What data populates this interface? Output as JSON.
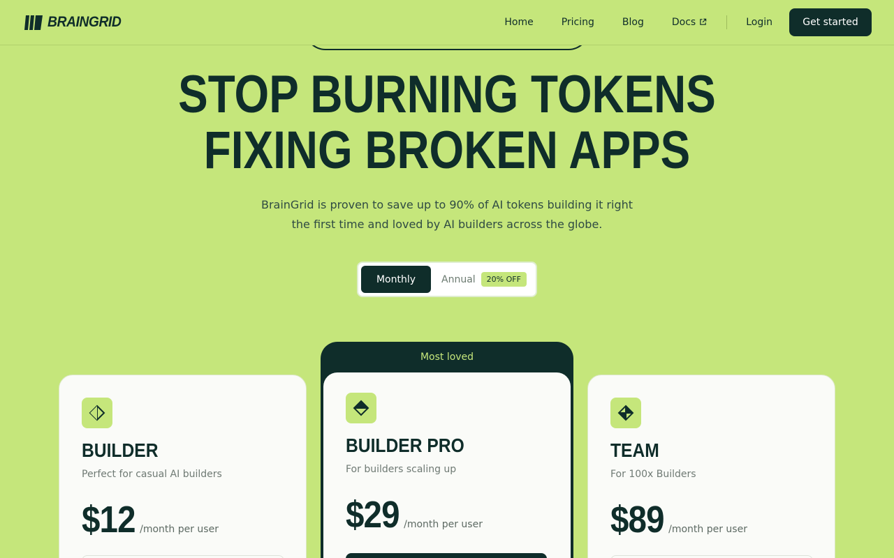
{
  "brand": {
    "name": "BRAINGRID",
    "icon": "braingrid-logo-icon"
  },
  "nav": {
    "links": [
      "Home",
      "Pricing",
      "Blog",
      "Docs"
    ],
    "docs_icon": "external-link-icon",
    "login": "Login",
    "cta": "Get started"
  },
  "hero": {
    "title_line1": "STOP BURNING TOKENS",
    "title_line2": "FIXING BROKEN APPS",
    "subtitle": "BrainGrid is proven to save up to 90% of AI tokens building it right the first time and loved by AI builders across the globe."
  },
  "billing_toggle": {
    "monthly": "Monthly",
    "annual": "Annual",
    "annual_badge": "20% OFF",
    "selected": "Monthly"
  },
  "plans": [
    {
      "name": "BUILDER",
      "desc": "Perfect for casual AI builders",
      "price": "$12",
      "unit": "/month per user",
      "icon": "diamond-half-icon"
    },
    {
      "name": "BUILDER PRO",
      "desc": "For builders scaling up",
      "price": "$29",
      "unit": "/month per user",
      "icon": "diamond-split-icon",
      "highlight": "Most loved"
    },
    {
      "name": "TEAM",
      "desc": "For 100x Builders",
      "price": "$89",
      "unit": "/month per user",
      "icon": "diamond-quad-icon"
    }
  ],
  "colors": {
    "background": "#c5e67b",
    "dark": "#0f2d2a",
    "card": "#fafbf8"
  }
}
